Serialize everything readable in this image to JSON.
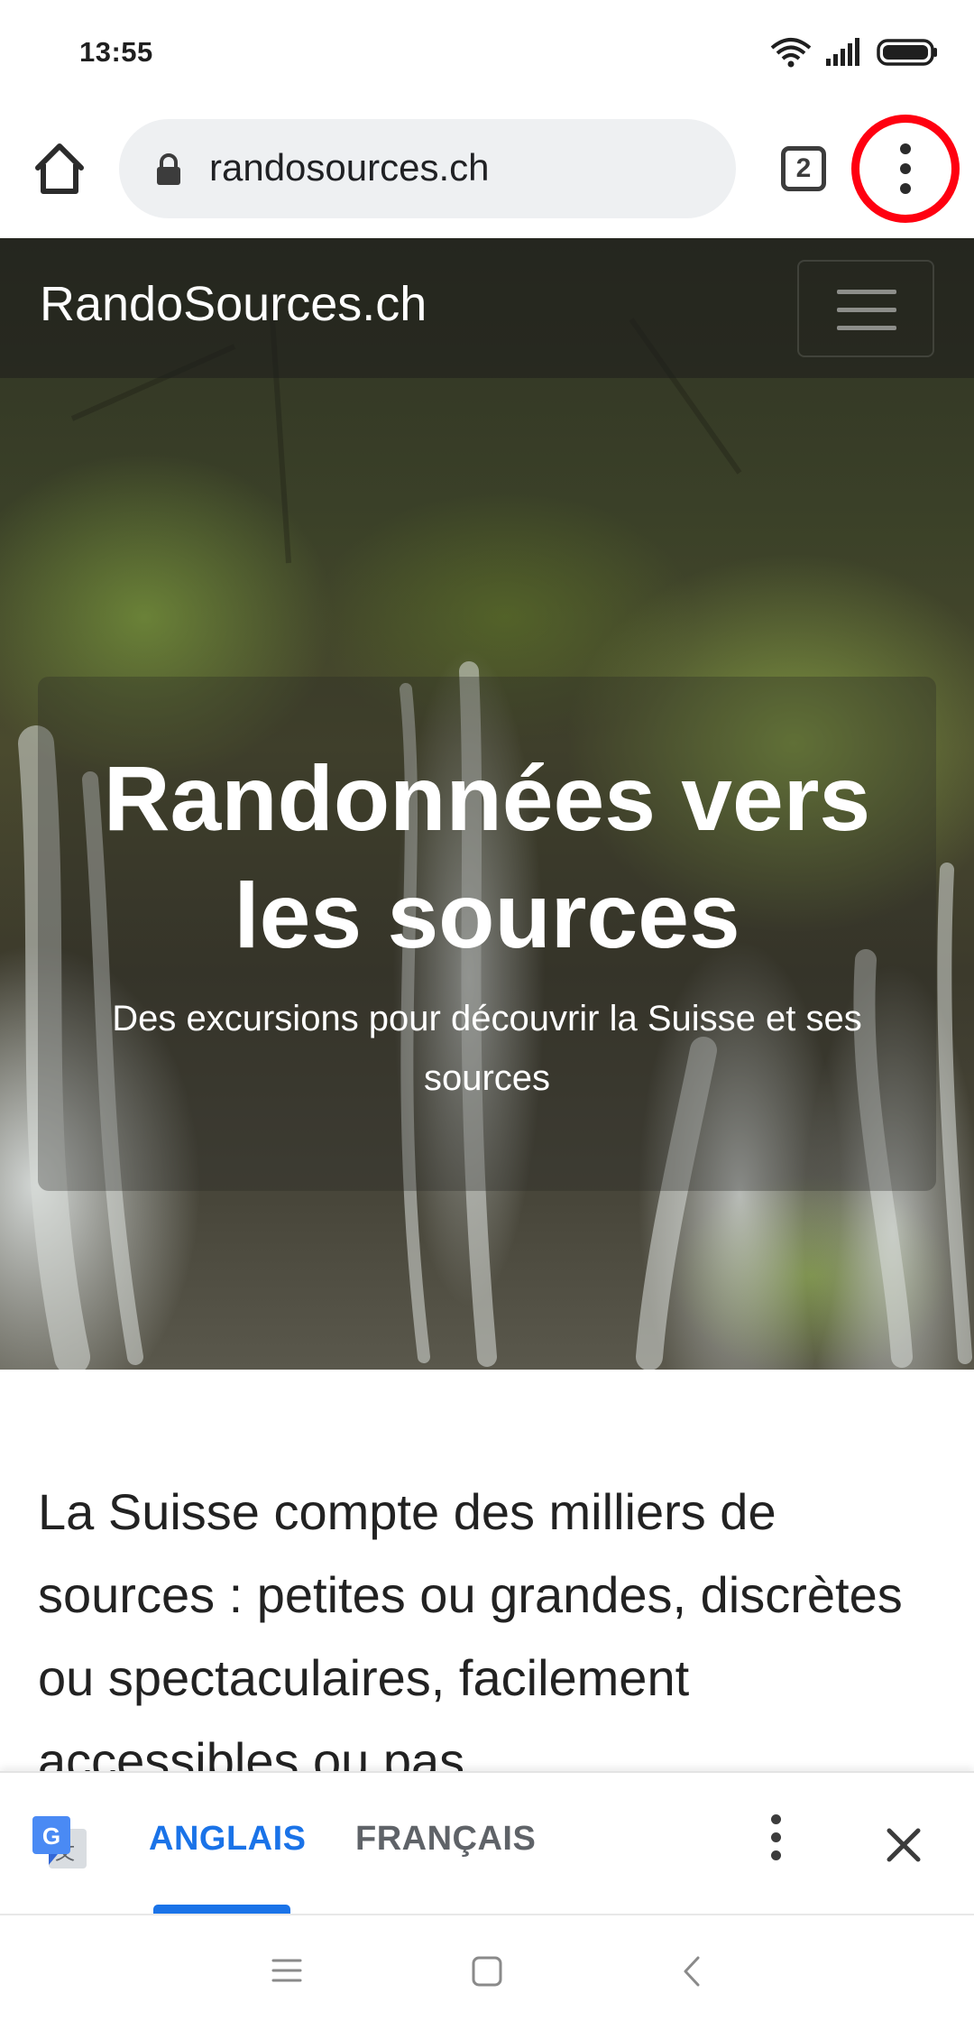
{
  "status_bar": {
    "time": "13:55"
  },
  "browser": {
    "url": "randosources.ch",
    "tab_count": "2"
  },
  "site": {
    "brand": "RandoSources.ch",
    "hero_title_line1": "Randonnées vers",
    "hero_title_line2": "les sources",
    "hero_subtitle": "Des excursions pour découvrir la Suisse et ses sources",
    "intro_text": "La Suisse compte des milliers de sources : petites ou grandes, discrètes ou spectaculaires, facilement accessibles ou pas."
  },
  "translate_bar": {
    "languages": [
      "ANGLAIS",
      "FRANÇAIS"
    ],
    "selected": "ANGLAIS"
  },
  "colors": {
    "accent_blue": "#1a73e8",
    "highlight_red": "#ff0010"
  }
}
